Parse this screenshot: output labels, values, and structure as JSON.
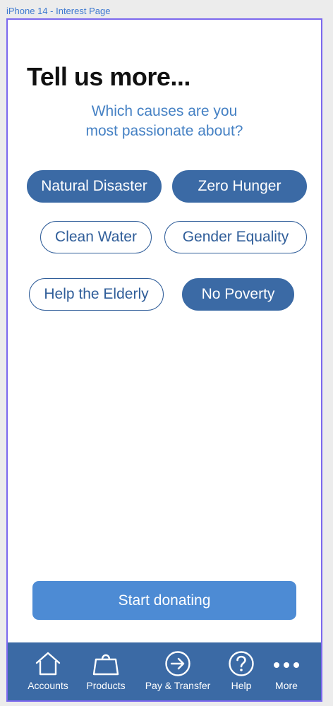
{
  "frame_label": "iPhone 14 - Interest Page",
  "header": {
    "title": "Tell us more...",
    "subtitle_line1": "Which causes are you",
    "subtitle_line2": "most passionate about?"
  },
  "causes": [
    {
      "label": "Natural Disaster",
      "selected": true
    },
    {
      "label": "Zero Hunger",
      "selected": true
    },
    {
      "label": "Clean Water",
      "selected": false
    },
    {
      "label": "Gender Equality",
      "selected": false
    },
    {
      "label": "Help the Elderly",
      "selected": false
    },
    {
      "label": "No Poverty",
      "selected": true
    }
  ],
  "cta": {
    "label": "Start donating"
  },
  "tabbar": {
    "items": [
      {
        "label": "Accounts",
        "icon": "home-icon"
      },
      {
        "label": "Products",
        "icon": "bag-icon"
      },
      {
        "label": "Pay & Transfer",
        "icon": "arrow-circle-icon"
      },
      {
        "label": "Help",
        "icon": "question-circle-icon"
      },
      {
        "label": "More",
        "icon": "more-dots-icon"
      }
    ]
  },
  "colors": {
    "primary": "#3b6aa5",
    "button": "#4d8bd4",
    "subtitle": "#4581c4",
    "frame_border": "#7b68ee"
  }
}
